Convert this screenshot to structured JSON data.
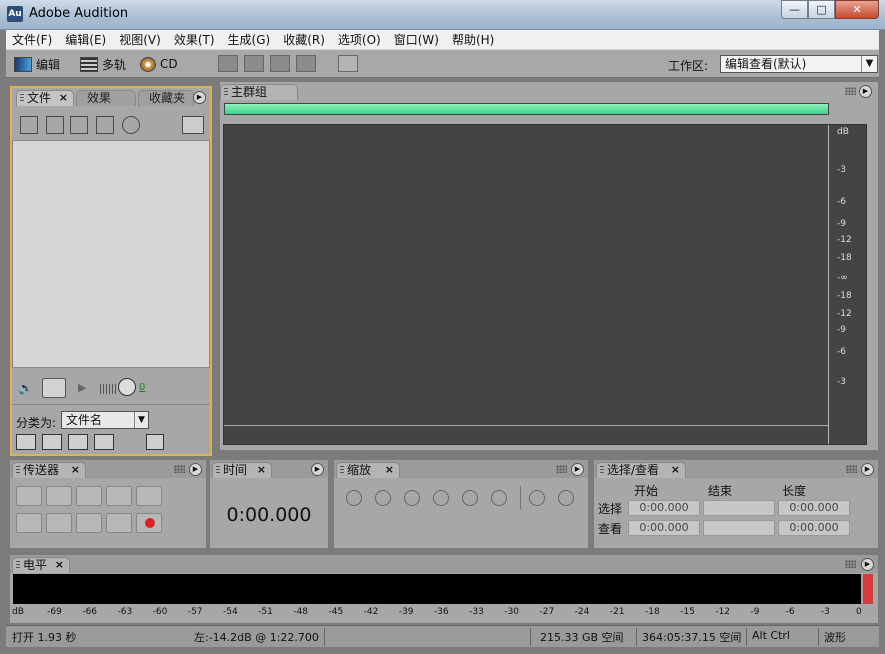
{
  "window": {
    "title": "Adobe Audition",
    "app_icon": "Au"
  },
  "menu": [
    "文件(F)",
    "编辑(E)",
    "视图(V)",
    "效果(T)",
    "生成(G)",
    "收藏(R)",
    "选项(O)",
    "窗口(W)",
    "帮助(H)"
  ],
  "toolbar": {
    "edit_label": "编辑",
    "multitrack_label": "多轨",
    "cd_label": "CD",
    "workspace_label": "工作区:",
    "workspace_value": "编辑查看(默认)"
  },
  "file_panel": {
    "tabs": [
      "文件",
      "效果",
      "收藏夹"
    ],
    "level_value": "0",
    "sort_label": "分类为:",
    "sort_value": "文件名"
  },
  "main_group": {
    "title": "主群组",
    "progress": 1.0
  },
  "db_ruler": [
    "dB",
    "-3",
    "-6",
    "-9",
    "-12",
    "-18",
    "-∞",
    "-18",
    "-12",
    "-9",
    "-6",
    "-3"
  ],
  "transport": {
    "title": "传送器"
  },
  "time": {
    "title": "时间",
    "value": "0:00.000"
  },
  "zoom": {
    "title": "缩放"
  },
  "selection": {
    "title": "选择/查看",
    "headers": [
      "开始",
      "结束",
      "长度"
    ],
    "rows": [
      {
        "label": "选择",
        "start": "0:00.000",
        "end": "",
        "length": "0:00.000"
      },
      {
        "label": "查看",
        "start": "0:00.000",
        "end": "",
        "length": "0:00.000"
      }
    ]
  },
  "level": {
    "title": "电平",
    "scale": [
      "dB",
      "-69",
      "-66",
      "-63",
      "-60",
      "-57",
      "-54",
      "-51",
      "-48",
      "-45",
      "-42",
      "-39",
      "-36",
      "-33",
      "-30",
      "-27",
      "-24",
      "-21",
      "-18",
      "-15",
      "-12",
      "-9",
      "-6",
      "-3",
      "0"
    ]
  },
  "status": {
    "open_time": "打开 1.93 秒",
    "left_info": "左:-14.2dB @ 1:22.700",
    "disk_free": "215.33 GB 空间",
    "time_free": "364:05:37.15 空间",
    "modifier": "Alt Ctrl",
    "view_mode": "波形"
  },
  "colors": {
    "accent_border": "#e2b24a",
    "progress": "#3fd08a",
    "clip": "#d63a3a"
  }
}
